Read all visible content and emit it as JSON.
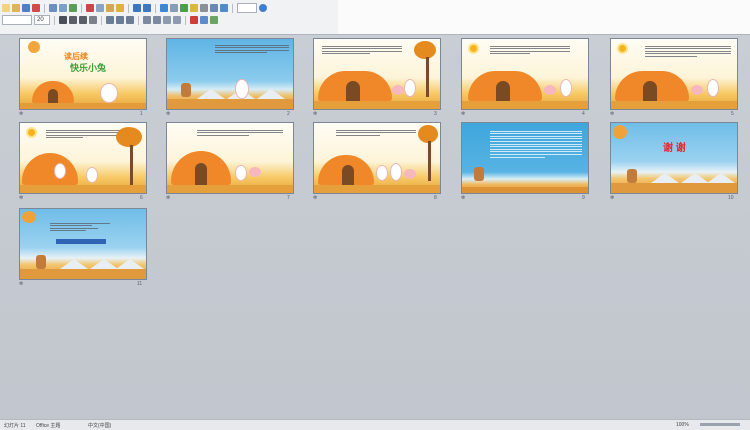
{
  "toolbar": {
    "font_size_value": "20",
    "icons": [
      "new-icon",
      "open-icon",
      "save-icon",
      "print-icon",
      "preview-icon",
      "copy-icon",
      "paste-icon",
      "undo-icon",
      "redo-icon",
      "table-icon",
      "chart-icon",
      "zoom-icon",
      "help-icon"
    ]
  },
  "slides": [
    {
      "num": "1",
      "title_line1": "读后续",
      "title_line2": "快乐小兔"
    },
    {
      "num": "2",
      "text": "兔子找到了一个下雨天，冬冬拿不到蘑菇。\n它想：这雨下得有好大，很快就淋湿了，在家都不行，所以只好冒着雨来找了。"
    },
    {
      "num": "3",
      "text": "小白兔走了一天了，终于到了一个萝卜屋。它敲了敲门，里面的小猪问：“谁呀？”它说：“是我小白兔。”"
    },
    {
      "num": "4",
      "text": "小猪看到小白兔浑身湿透了，连忙开门让它进来，还拿出干毛巾给它擦身上的水。"
    },
    {
      "num": "5",
      "text": "小白兔一边擦一边说：“谢谢你小猪！”小猪笑着说：“不用谢，我们是好朋友嘛！”"
    },
    {
      "num": "6",
      "text": "小猪说：“外面雨太大了，今天你就住在我家吧！”小白兔高兴地答应了。"
    },
    {
      "num": "7",
      "text": "它们一起吃了晚饭，还一起做游戏，玩得可开心了。"
    },
    {
      "num": "8",
      "text": "第二天，天晴了。小白兔要回家了，它对小猪说：“欢迎你到我家来玩！”"
    },
    {
      "num": "9",
      "text": "故事告诉我们：朋友之间要互相帮助，遇到困难时，好朋友会伸出援手……"
    },
    {
      "num": "10",
      "text": "谢 谢"
    },
    {
      "num": "11",
      "text": "思维导图：\n快乐小兔\n读后续写\n要求：想象合理"
    }
  ],
  "status": {
    "slide_info": "幻灯片 11",
    "theme": "Office 主题",
    "language": "中文(中国)",
    "zoom": "100%"
  }
}
